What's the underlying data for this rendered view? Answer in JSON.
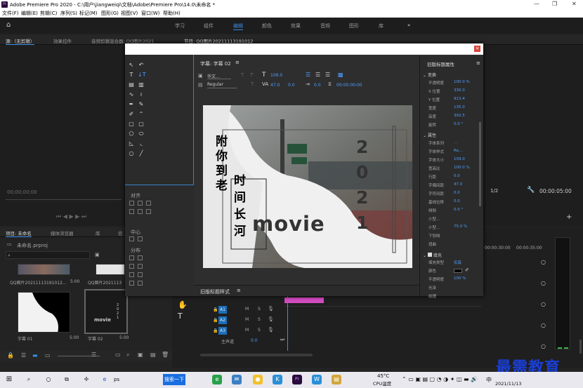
{
  "window": {
    "title": "Adobe Premiere Pro 2020 - C:\\用户\\jiangweiqi\\文档\\Adobe\\Premiere Pro\\14.0\\未命名 *",
    "app_badge": "Pr"
  },
  "menu": [
    "文件(F)",
    "编辑(E)",
    "剪辑(C)",
    "序列(S)",
    "标记(M)",
    "图形(G)",
    "视图(V)",
    "窗口(W)",
    "帮助(H)"
  ],
  "workspaces": {
    "items": [
      "学习",
      "组件",
      "编辑",
      "颜色",
      "效果",
      "音频",
      "图形",
      "库"
    ],
    "active": "编辑",
    "more": "»"
  },
  "panels": {
    "source_tab": "源:（无剪辑）",
    "effects_tab": "效果控件",
    "audio_mixer_tab": "音频剪辑混合器: QQ图片2021",
    "program_tab": "节目: QQ图片20211113191012",
    "source_timecode": "00;00;00;00",
    "program_fraction": "1/2",
    "program_timecode": "00:00:05:00"
  },
  "project": {
    "tab": "项目: 未命名",
    "tab2": "媒体浏览器",
    "tab3": "库",
    "tab4": "信",
    "file": "未命名.prproj",
    "items": [
      {
        "name": "QQ图片20211113191012...",
        "duration": "5:00"
      },
      {
        "name": "QQ图片2021113",
        "duration": ""
      },
      {
        "name": "字幕 01",
        "duration": "5:00"
      },
      {
        "name": "字幕 02",
        "duration": "5:00"
      }
    ]
  },
  "timeline": {
    "tracks": [
      "V1",
      "A1",
      "A2",
      "A3"
    ],
    "master": "主声道",
    "master_value": "0.0",
    "ruler": [
      "00:00:30:00",
      "00:00:35:00"
    ]
  },
  "titler": {
    "panel_title": "字幕: 字幕 02",
    "font": "华文...",
    "style": "Regular",
    "size": "109.0",
    "kerning": "47.0",
    "leading": "0.0",
    "tab": "0.0",
    "timecode": "00:00:00:00",
    "align_label": "对齐",
    "center_label": "中心",
    "distribute_label": "分布",
    "styles_label": "旧版标题样式",
    "canvas": {
      "text_vertical_left": [
        "附",
        "你",
        "到",
        "老"
      ],
      "text_vertical_right": [
        "时",
        "间",
        "长",
        "河"
      ],
      "year_digits": [
        "2",
        "0",
        "2",
        "1"
      ],
      "big_word": "movie"
    }
  },
  "properties": {
    "header": "旧版标题属性",
    "transform_label": "变换",
    "transform": [
      {
        "label": "不透明度",
        "value": "100.0 %"
      },
      {
        "label": "X 位置",
        "value": "330.0"
      },
      {
        "label": "Y 位置",
        "value": "913.4"
      },
      {
        "label": "宽度",
        "value": "135.0"
      },
      {
        "label": "高度",
        "value": "392.5"
      },
      {
        "label": "旋转",
        "value": "0.0 °"
      }
    ],
    "attributes_label": "属性",
    "attributes": [
      {
        "label": "字体系列",
        "value": "..."
      },
      {
        "label": "字体样式",
        "value": "Re..."
      },
      {
        "label": "字体大小",
        "value": "109.0"
      },
      {
        "label": "宽高比",
        "value": "100.0 %"
      },
      {
        "label": "行距",
        "value": "0.0"
      },
      {
        "label": "字偶间距",
        "value": "47.0"
      },
      {
        "label": "字符间距",
        "value": "0.0"
      },
      {
        "label": "基线位移",
        "value": "0.0"
      },
      {
        "label": "倾斜",
        "value": "0.0 °"
      },
      {
        "label": "小型...",
        "value": ""
      },
      {
        "label": "小型...",
        "value": "75.0 %"
      },
      {
        "label": "下划线",
        "value": ""
      },
      {
        "label": "扭曲",
        "value": ""
      }
    ],
    "fill_label": "填充",
    "fill": [
      {
        "label": "填充类型",
        "value": "实底"
      },
      {
        "label": "颜色",
        "value": ""
      },
      {
        "label": "不透明度",
        "value": "100 %"
      },
      {
        "label": "光泽",
        "value": ""
      },
      {
        "label": "纹理",
        "value": ""
      }
    ]
  },
  "taskbar": {
    "search": "ps",
    "search_btn": "搜索一下",
    "weather_temp": "45°C",
    "weather_label": "CPU温度",
    "ime": "中",
    "date": "2021/11/13"
  },
  "watermark": "最需教育",
  "colors": {
    "accent": "#3a8ee6",
    "track": "#1b6fb8",
    "clip": "#d44bc2"
  }
}
